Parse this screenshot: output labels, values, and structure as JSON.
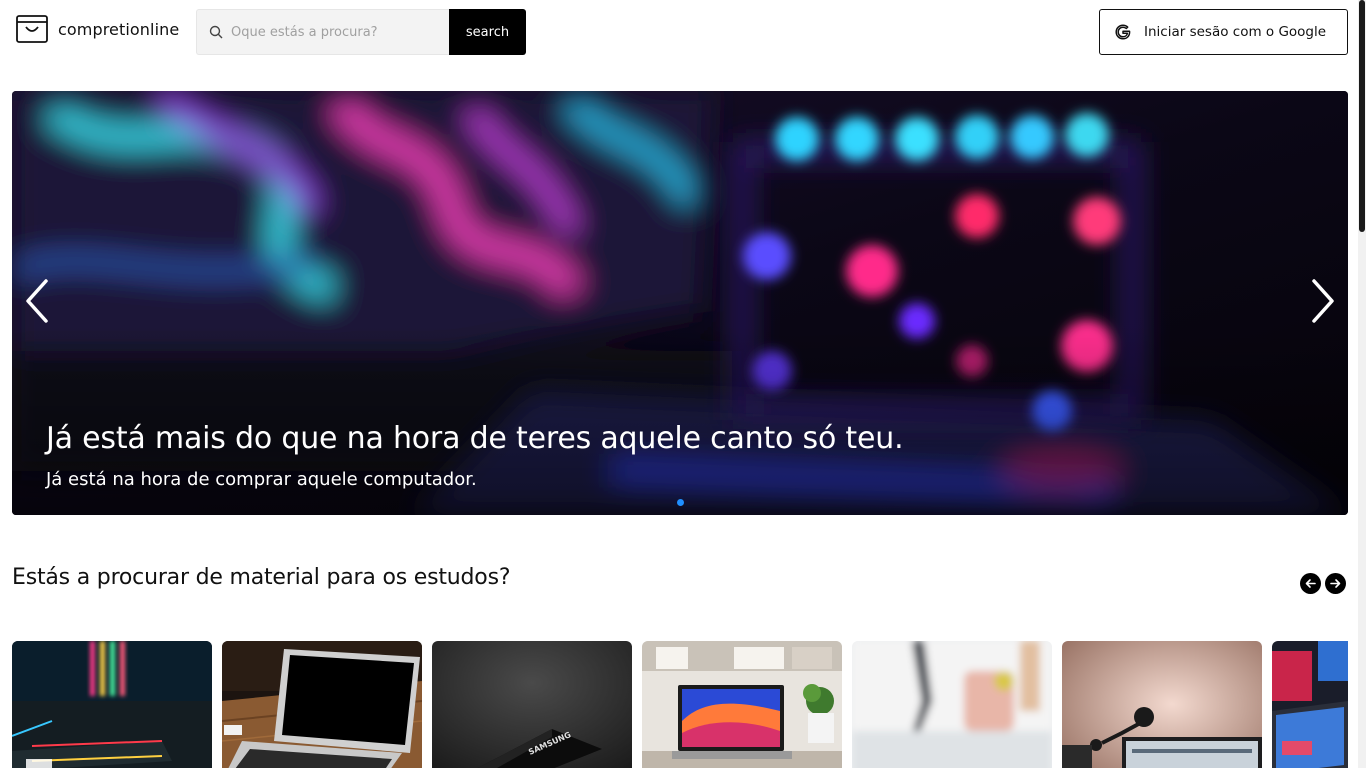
{
  "header": {
    "logo_text": "compretionline",
    "search_placeholder": "Oque estás a procura?",
    "search_button": "search",
    "google_button": "Iniciar sesão com o Google"
  },
  "hero": {
    "title": "Já está mais do que na hora de teres aquele canto só teu.",
    "subtitle": "Já está na hora de comprar aquele computador.",
    "prev_icon": "chevron-left-icon",
    "next_icon": "chevron-right-icon",
    "active_slide_color": "#1f8fff"
  },
  "section": {
    "title": "Estás a procurar de material para os estudos?",
    "prev_icon": "arrow-left-icon",
    "next_icon": "arrow-right-icon"
  },
  "products": [
    {
      "image": "rgb-ram-motherboard"
    },
    {
      "image": "laptop-on-desk"
    },
    {
      "image": "samsung-ssd"
    },
    {
      "image": "macbook-on-desk"
    },
    {
      "image": "blurred-room"
    },
    {
      "image": "desk-lamp-monitor"
    },
    {
      "image": "gaming-setup"
    }
  ]
}
